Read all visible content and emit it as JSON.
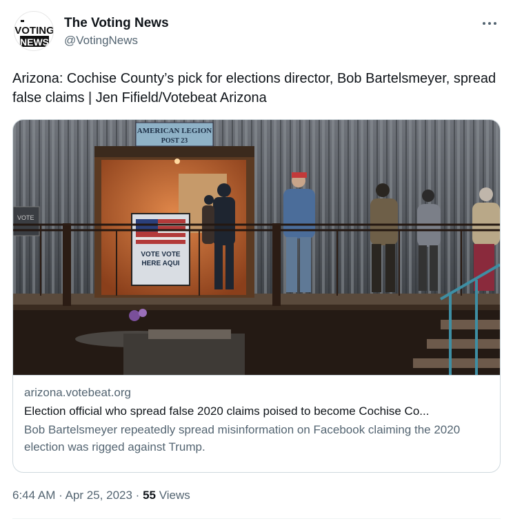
{
  "author": {
    "display_name": "The Voting News",
    "handle": "@VotingNews",
    "avatar_logo": [
      "VOTING",
      "NEWS"
    ]
  },
  "tweet": {
    "text": "Arizona: Cochise County’s pick for elections director, Bob Bartelsmeyer, spread false claims | Jen Fifield/Votebeat Arizona"
  },
  "card": {
    "image_signs": {
      "legion_line1": "AMERICAN LEGION",
      "legion_line2": "POST 23",
      "vote_line1": "VOTE VOTE",
      "vote_line2": "HERE AQUI",
      "side_sign": "VOTE"
    },
    "domain": "arizona.votebeat.org",
    "title": "Election official who spread false 2020 claims poised to become Cochise Co...",
    "description": "Bob Bartelsmeyer repeatedly spread misinformation on Facebook claiming the 2020 election was rigged against Trump."
  },
  "meta": {
    "time": "6:44 AM",
    "separator": "·",
    "date": "Apr 25, 2023",
    "views_count": "55",
    "views_label": "Views"
  },
  "icons": {
    "more": "more-horizontal-icon"
  },
  "colors": {
    "text_primary": "#0f1419",
    "text_secondary": "#536471",
    "border": "#cfd9de"
  }
}
